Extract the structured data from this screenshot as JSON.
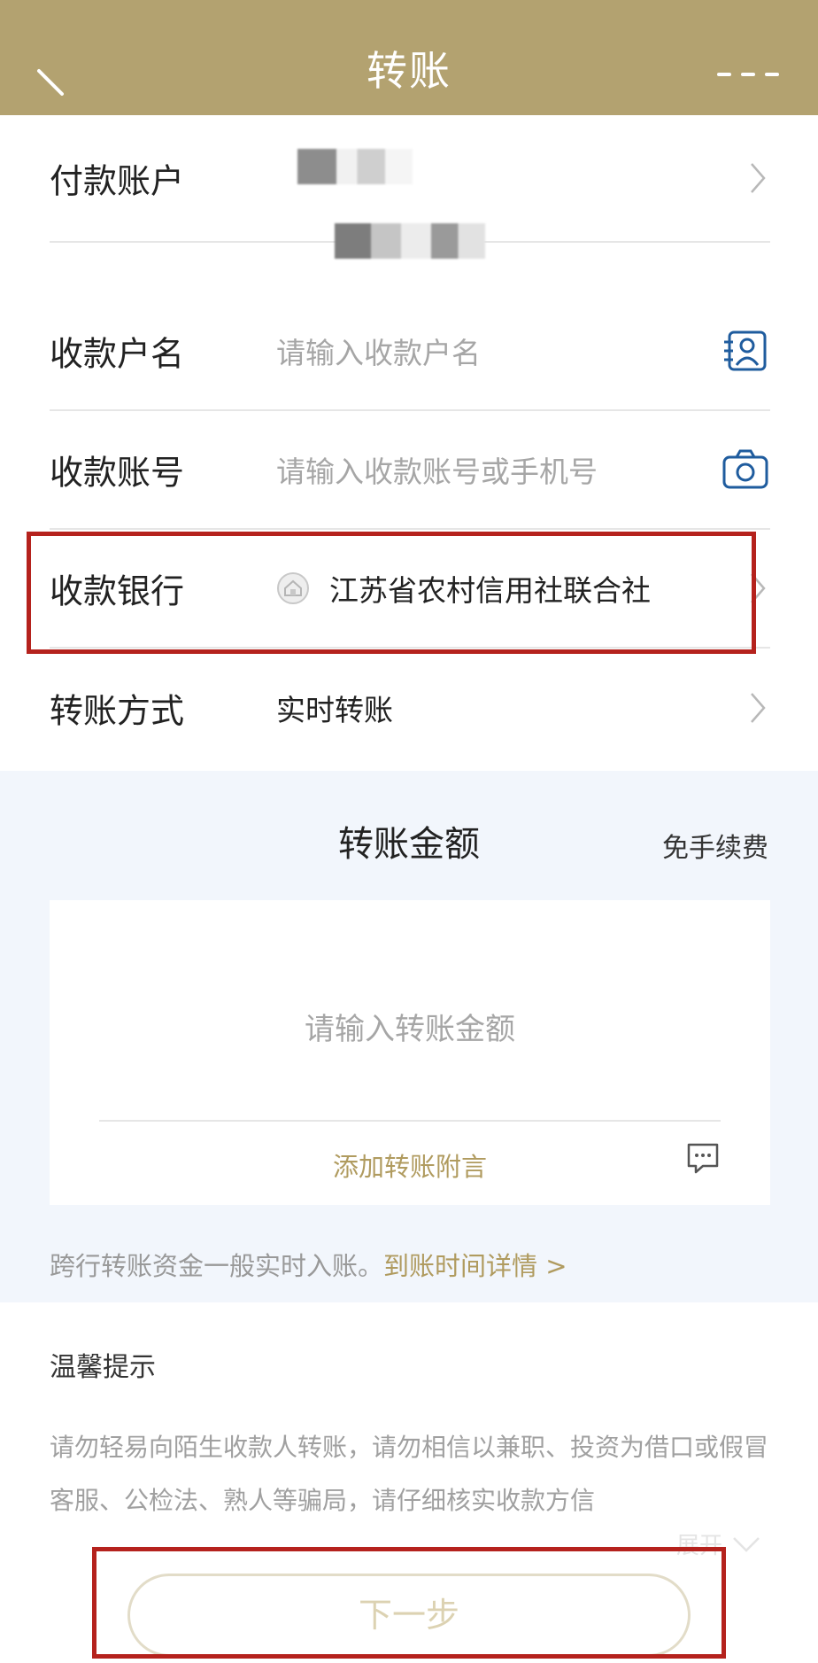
{
  "header": {
    "title": "转账"
  },
  "form": {
    "payer": {
      "label": "付款账户"
    },
    "payee_name": {
      "label": "收款户名",
      "placeholder": "请输入收款户名"
    },
    "payee_account": {
      "label": "收款账号",
      "placeholder": "请输入收款账号或手机号"
    },
    "payee_bank": {
      "label": "收款银行",
      "value": "江苏省农村信用社联合社"
    },
    "transfer_mode": {
      "label": "转账方式",
      "value": "实时转账"
    }
  },
  "amount": {
    "title": "转账金额",
    "fee_note": "免手续费",
    "placeholder": "请输入转账金额",
    "add_note": "添加转账附言",
    "notice_text": "跨行转账资金一般实时入账。",
    "notice_link": "到账时间详情 >"
  },
  "tips": {
    "title": "温馨提示",
    "text": "请勿轻易向陌生收款人转账，请勿相信以兼职、投资为借口或假冒客服、公检法、熟人等骗局，请仔细核实收款方信",
    "expand_label": "展开"
  },
  "footer": {
    "next_label": "下一步"
  },
  "colors": {
    "brand": "#b3a270",
    "highlight": "#b5221d",
    "icon": "#1f5c9e"
  },
  "icons": [
    "back-icon",
    "more-icon",
    "chevron-right-icon",
    "contact-book-icon",
    "camera-icon",
    "bank-logo-icon",
    "comment-icon",
    "chevron-down-icon"
  ]
}
